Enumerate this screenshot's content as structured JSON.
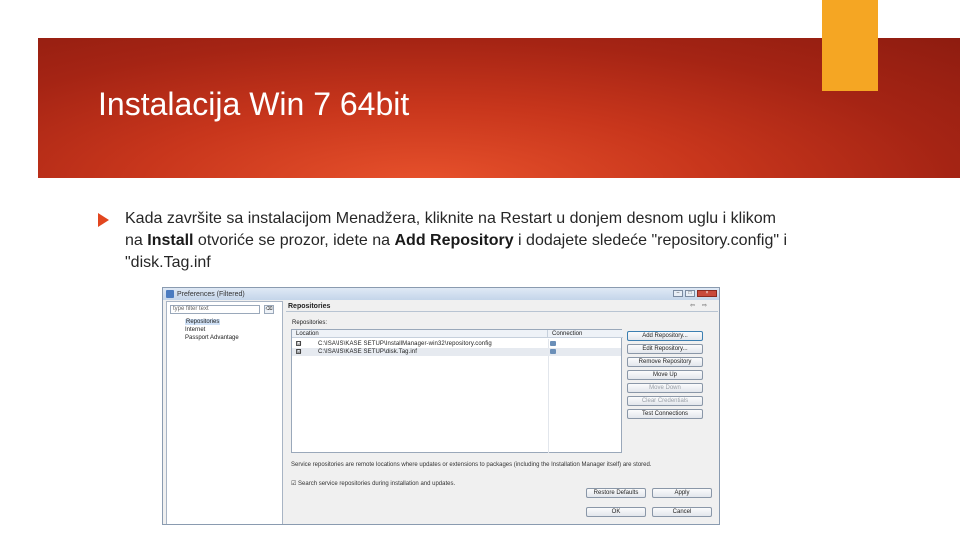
{
  "slide": {
    "title": "Instalacija Win 7 64bit",
    "bullet": {
      "part1": "Kada završite sa instalacijom Menadžera, kliknite na Restart u donjem desnom uglu i klikom na ",
      "bold1": "Install",
      "part2": " otvoriće se prozor, idete na ",
      "bold2": "Add Repository",
      "part3": " i dodajete sledeće \"repository.config\" i \"disk.Tag.inf"
    }
  },
  "colors": {
    "banner": "#b22a16",
    "accent": "#f5a623",
    "bullet": "#e2461f"
  },
  "dialog": {
    "title": "Preferences (Filtered)",
    "filter_placeholder": "type filter text",
    "tree": [
      "Repositories",
      "Internet",
      "Passport Advantage"
    ],
    "pane_title": "Repositories",
    "section_label": "Repositories:",
    "columns": [
      "Location",
      "Connection"
    ],
    "rows": [
      {
        "checked": "☑",
        "path": "C:\\ISA\\IS\\KASE SETUP\\InstallManager-win32\\repository.config"
      },
      {
        "checked": "☑",
        "path": "C:\\ISA\\IS\\KASE SETUP\\disk.Tag.inf"
      }
    ],
    "buttons": [
      "Add Repository...",
      "Edit Repository...",
      "Remove Repository",
      "Move Up",
      "Move Down",
      "Clear Credentials",
      "Test Connections"
    ],
    "note": "Service repositories are remote locations where updates or extensions to packages (including the Installation Manager itself) are stored.",
    "search_option": "☑ Search service repositories during installation and updates.",
    "restore_label": "Restore Defaults",
    "apply_label": "Apply",
    "ok_label": "OK",
    "cancel_label": "Cancel"
  }
}
